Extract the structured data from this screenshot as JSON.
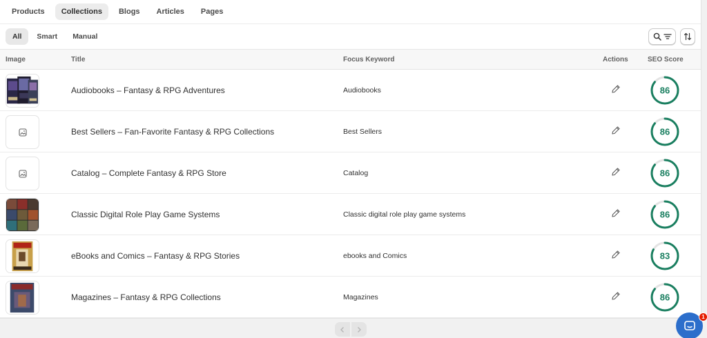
{
  "nav": {
    "tabs": [
      {
        "label": "Products",
        "active": false
      },
      {
        "label": "Collections",
        "active": true
      },
      {
        "label": "Blogs",
        "active": false
      },
      {
        "label": "Articles",
        "active": false
      },
      {
        "label": "Pages",
        "active": false
      }
    ]
  },
  "filters": {
    "tabs": [
      {
        "label": "All",
        "active": true
      },
      {
        "label": "Smart",
        "active": false
      },
      {
        "label": "Manual",
        "active": false
      }
    ],
    "search_icon": "search-icon",
    "filter_icon": "filter-lines-icon",
    "sort_icon": "sort-arrows-icon"
  },
  "table": {
    "headers": {
      "image": "Image",
      "title": "Title",
      "keyword": "Focus Keyword",
      "actions": "Actions",
      "score": "SEO Score"
    },
    "rows": [
      {
        "title": "Audiobooks – Fantasy & RPG Adventures",
        "keyword": "Audiobooks",
        "score": "86",
        "score_fraction": 0.86,
        "image": "audiobook-covers-thumbnail"
      },
      {
        "title": "Best Sellers – Fan-Favorite Fantasy & RPG Collections",
        "keyword": "Best Sellers",
        "score": "86",
        "score_fraction": 0.86,
        "image": "image-placeholder-icon"
      },
      {
        "title": "Catalog – Complete Fantasy & RPG Store",
        "keyword": "Catalog",
        "score": "86",
        "score_fraction": 0.86,
        "image": "image-placeholder-icon"
      },
      {
        "title": "Classic Digital Role Play Game Systems",
        "keyword": "Classic digital role play game systems",
        "score": "86",
        "score_fraction": 0.86,
        "image": "rpg-collage-thumbnail"
      },
      {
        "title": "eBooks and Comics – Fantasy & RPG Stories",
        "keyword": "ebooks and Comics",
        "score": "83",
        "score_fraction": 0.83,
        "image": "comic-cover-thumbnail"
      },
      {
        "title": "Magazines – Fantasy & RPG Collections",
        "keyword": "Magazines",
        "score": "86",
        "score_fraction": 0.86,
        "image": "magazine-cover-thumbnail"
      }
    ]
  },
  "pager": {
    "prev_icon": "chevron-left-icon",
    "next_icon": "chevron-right-icon"
  },
  "chat": {
    "icon": "chat-bubble-icon",
    "badge_count": "1"
  },
  "colors": {
    "score_ring": "#1a7f60",
    "score_track": "#e3e3e3",
    "chat_button": "#2c6ecb",
    "badge": "#e51c00"
  }
}
